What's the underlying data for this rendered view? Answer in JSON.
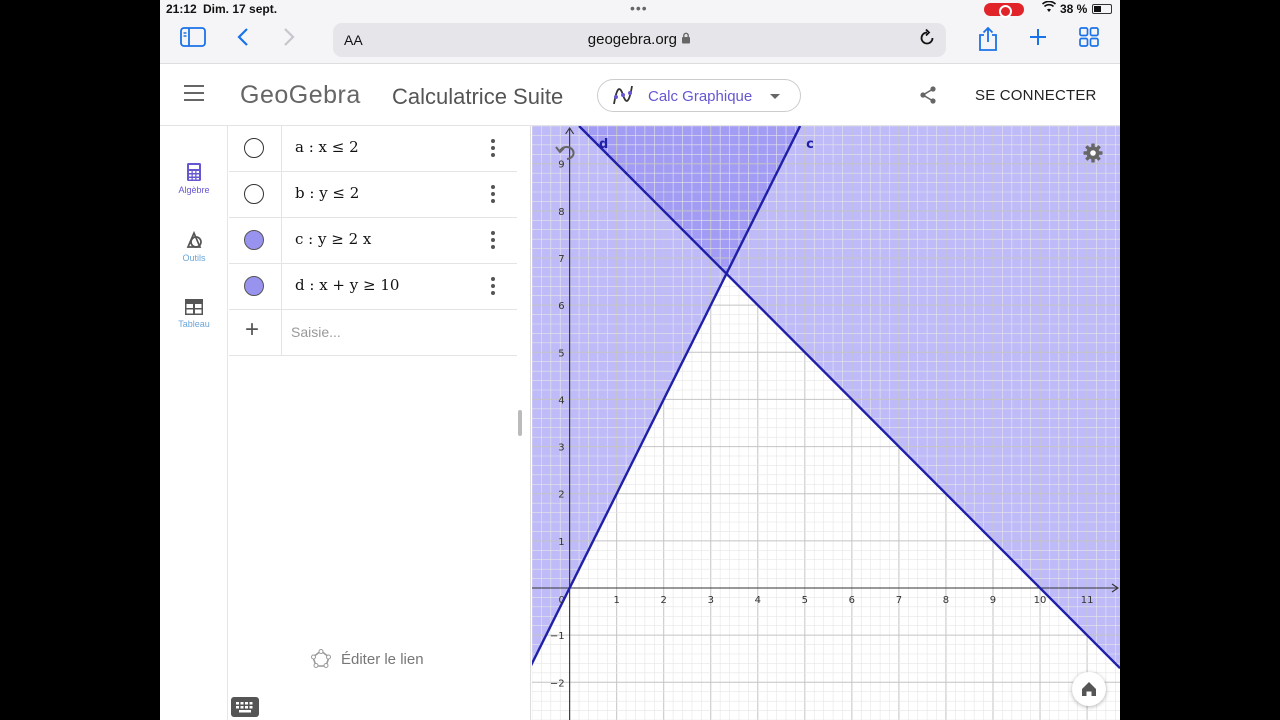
{
  "status_bar": {
    "time": "21:12",
    "date": "Dim. 17 sept.",
    "battery": "38 %"
  },
  "browser": {
    "text_size": "AA",
    "url": "geogebra.org"
  },
  "header": {
    "logo": "GeoGebra",
    "title": "Calculatrice Suite",
    "app_switch": "Calc Graphique",
    "sign_in": "SE CONNECTER"
  },
  "sidenav": [
    {
      "label": "Algèbre",
      "icon": "calculator-icon",
      "active": true
    },
    {
      "label": "Outils",
      "icon": "tools-icon",
      "active": false
    },
    {
      "label": "Tableau",
      "icon": "table-icon",
      "active": false
    }
  ],
  "algebra": {
    "rows": [
      {
        "definition": "a : x ≤ 2",
        "visible": false
      },
      {
        "definition": "b : y ≤ 2",
        "visible": false
      },
      {
        "definition": "c : y ≥ 2 x",
        "visible": true
      },
      {
        "definition": "d : x + y ≥ 10",
        "visible": true
      }
    ],
    "input_placeholder": "Saisie...",
    "edit_link": "Éditer le lien"
  },
  "graph": {
    "x_ticks": [
      "0",
      "1",
      "2",
      "3",
      "4",
      "5",
      "6",
      "7",
      "8",
      "9",
      "10",
      "11"
    ],
    "y_ticks": [
      "−2",
      "−1",
      "1",
      "2",
      "3",
      "4",
      "5",
      "6",
      "7",
      "8",
      "9"
    ],
    "line_labels": [
      "d",
      "c"
    ],
    "x_range": [
      -0.8,
      11.7
    ],
    "y_range": [
      -2.8,
      9.8
    ],
    "fill_color": "#8a83f2",
    "line_color": "#1f1fa8",
    "inequalities": [
      "y ≥ 2x",
      "x + y ≥ 10"
    ]
  },
  "colors": {
    "accent": "#6557d2",
    "ios_blue": "#1a73e8"
  }
}
